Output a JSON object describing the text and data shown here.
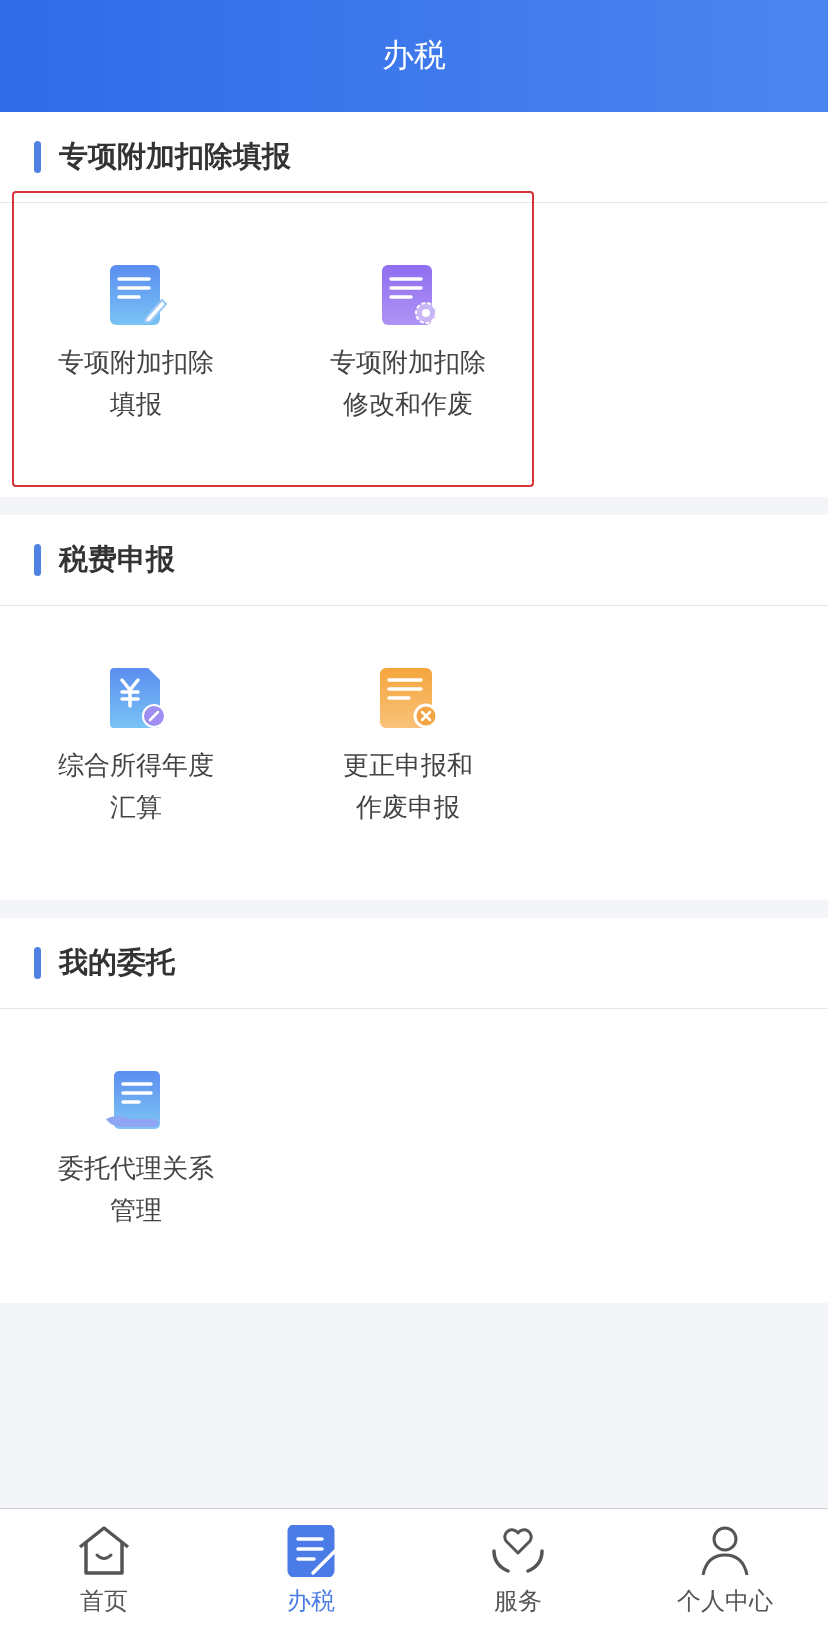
{
  "header": {
    "title": "办税"
  },
  "sections": [
    {
      "title": "专项附加扣除填报",
      "highlighted": true,
      "items": [
        {
          "kind": "edit",
          "lines": [
            "专项附加扣除",
            "填报"
          ]
        },
        {
          "kind": "settings",
          "lines": [
            "专项附加扣除",
            "修改和作废"
          ]
        }
      ]
    },
    {
      "title": "税费申报",
      "highlighted": false,
      "items": [
        {
          "kind": "yuan",
          "lines": [
            "综合所得年度",
            "汇算"
          ]
        },
        {
          "kind": "void",
          "lines": [
            "更正申报和",
            "作废申报"
          ]
        }
      ]
    },
    {
      "title": "我的委托",
      "highlighted": false,
      "items": [
        {
          "kind": "hand",
          "lines": [
            "委托代理关系",
            "管理"
          ]
        }
      ]
    }
  ],
  "tabs": [
    {
      "kind": "home",
      "label": "首页",
      "selected": false
    },
    {
      "kind": "tax",
      "label": "办税",
      "selected": true
    },
    {
      "kind": "service",
      "label": "服务",
      "selected": false
    },
    {
      "kind": "person",
      "label": "个人中心",
      "selected": false
    }
  ]
}
